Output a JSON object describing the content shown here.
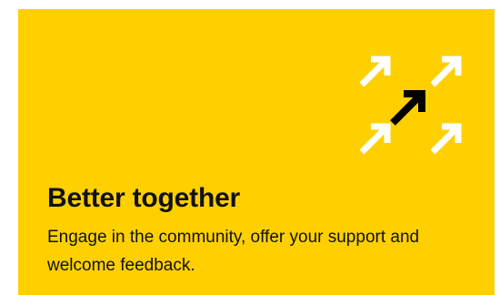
{
  "card": {
    "background_color": "#FFD000",
    "title": "Better together",
    "description": "Engage in the community, offer your support and welcome feedback.",
    "illustration": {
      "icon": "arrows-converging-icon",
      "primary_arrow_color": "#000000",
      "secondary_arrow_color": "#FFFFFF"
    }
  }
}
